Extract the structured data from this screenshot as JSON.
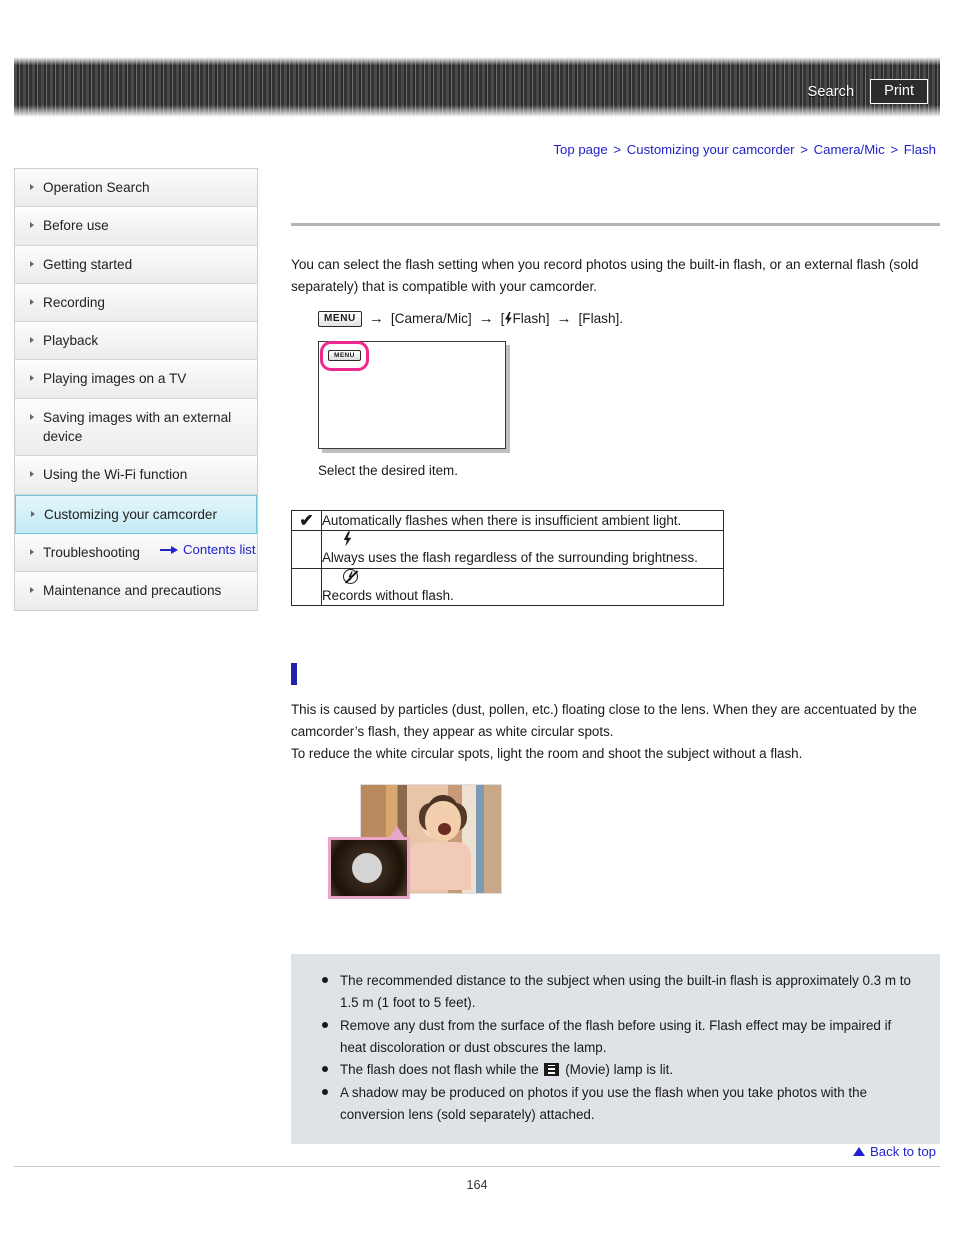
{
  "header": {
    "search_label": "Search",
    "print_label": "Print",
    "banner_color": "#3a3a3a"
  },
  "breadcrumb": {
    "separator": ">",
    "items": [
      {
        "label": "Top page"
      },
      {
        "label": "Customizing your camcorder"
      },
      {
        "label": "Camera/Mic"
      },
      {
        "label": "Flash"
      }
    ],
    "link_color": "#2222cc"
  },
  "sidebar": {
    "items": [
      {
        "label": "Operation Search",
        "active": false
      },
      {
        "label": "Before use",
        "active": false
      },
      {
        "label": "Getting started",
        "active": false
      },
      {
        "label": "Recording",
        "active": false
      },
      {
        "label": "Playback",
        "active": false
      },
      {
        "label": "Playing images on a TV",
        "active": false
      },
      {
        "label": "Saving images with an external device",
        "active": false
      },
      {
        "label": "Using the Wi-Fi function",
        "active": false
      },
      {
        "label": "Customizing your camcorder",
        "active": true
      },
      {
        "label": "Troubleshooting",
        "active": false
      },
      {
        "label": "Maintenance and precautions",
        "active": false
      }
    ],
    "contents_list_label": "Contents list",
    "active_color": "#c6ebf6"
  },
  "main": {
    "intro_line1": "You can select the flash setting when you record photos using the built-in flash, or an external flash",
    "intro_line2": "(sold separately) that is compatible with your camcorder.",
    "menu_path": {
      "menu_badge": "MENU",
      "arrow": "→",
      "step1": "[Camera/Mic]",
      "step2_prefix": "[",
      "step2_label": "Flash]",
      "step3": "[Flash]."
    },
    "screen_menu_label": "MENU",
    "screen_highlight_color": "#ec2a8e",
    "caption": "Select the desired item."
  },
  "options_table": {
    "rows": [
      {
        "check": "✔",
        "icon": "",
        "description": "Automatically flashes when there is insufficient ambient light."
      },
      {
        "check": "",
        "icon": "flash-on-icon",
        "description": "Always uses the flash regardless of the surrounding brightness."
      },
      {
        "check": "",
        "icon": "flash-off-icon",
        "description": "Records without flash."
      }
    ]
  },
  "section": {
    "marker_color": "#2222aa",
    "body_line1": "This is caused by particles (dust, pollen, etc.) floating close to the lens. When they are accentuated by",
    "body_line2": "the camcorder’s flash, they appear as white circular spots.",
    "body_line3": "To reduce the white circular spots, light the room and shoot the subject without a flash."
  },
  "notes": {
    "background": "#dfe2e6",
    "items": [
      "The recommended distance to the subject when using the built-in flash is approximately 0.3 m to 1.5 m (1 foot to 5 feet).",
      "Remove any dust from the surface of the flash before using it. Flash effect may be impaired if heat discoloration or dust obscures the lamp.",
      "A shadow may be produced on photos if you use the flash when you take photos with the conversion lens (sold separately) attached."
    ],
    "movie_note_prefix": "The flash does not flash while the",
    "movie_note_suffix": "(Movie) lamp is lit."
  },
  "footer": {
    "back_to_top_label": "Back to top",
    "page_number": "164"
  }
}
